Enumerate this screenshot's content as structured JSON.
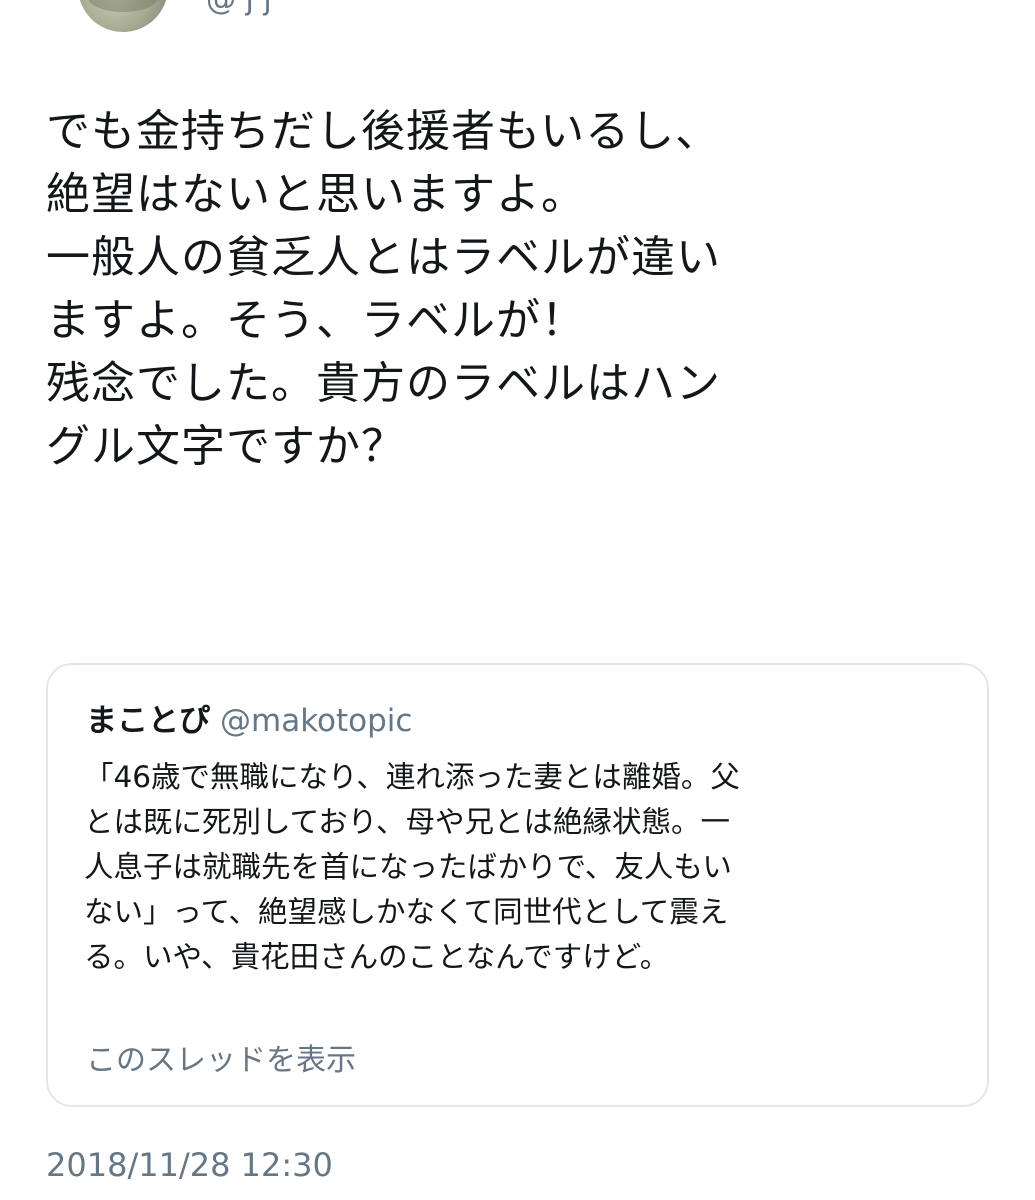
{
  "tweet": {
    "handle_fragment": "@   j  j",
    "text_lines": [
      "でも金持ちだし後援者もいるし、",
      "絶望はないと思いますよ。",
      "一般人の貧乏人とはラベルが違い",
      "ますよ。そう、ラベルが！",
      "残念でした。貴方のラベルはハン",
      "グル文字ですか？"
    ],
    "timestamp": "2018/11/28 12:30"
  },
  "quoted_tweet": {
    "display_name": "まことぴ",
    "handle": "@makotopic",
    "text_lines": [
      "「46歳で無職になり、連れ添った妻とは離婚。父",
      "とは既に死別しており、母や兄とは絶縁状態。一",
      "人息子は就職先を首になったばかりで、友人もい",
      "ない」って、絶望感しかなくて同世代として震え",
      "る。いや、貴花田さんのことなんですけど。"
    ],
    "show_thread_label": "このスレッドを表示"
  }
}
